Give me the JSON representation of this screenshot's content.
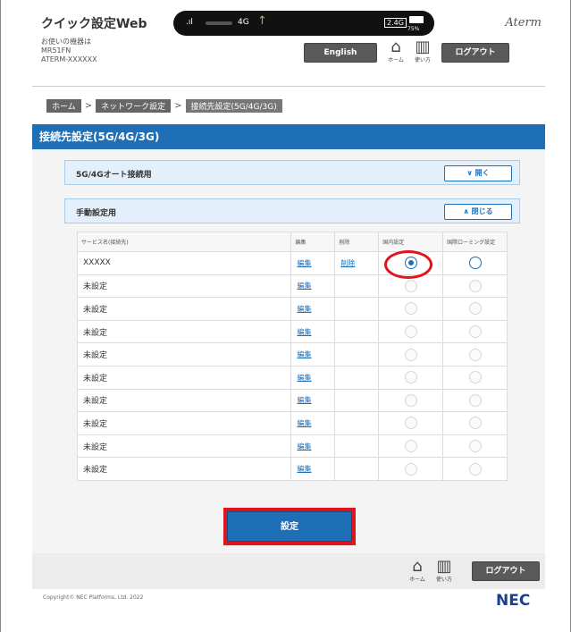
{
  "header": {
    "app_title": "クイック設定Web",
    "device_label": "お使いの機器は",
    "device_model": "MR51FN",
    "device_name": "ATERM-XXXXXX",
    "brand": "Aterm",
    "status": {
      "signal": ".ıl",
      "network": "4G",
      "band": "2.4G",
      "battery": "75%"
    },
    "english_label": "English",
    "home_caption": "ホーム",
    "help_caption": "使い方",
    "logout_label": "ログアウト"
  },
  "breadcrumb": [
    "ホーム",
    "ネットワーク設定",
    "接続先設定(5G/4G/3G)"
  ],
  "breadcrumb_sep": ">",
  "section_title": "接続先設定(5G/4G/3G)",
  "accordions": [
    {
      "label": "5G/4Gオート接続用",
      "button": "開く",
      "icon": "chevron-down-icon"
    },
    {
      "label": "手動設定用",
      "button": "閉じる",
      "icon": "chevron-up-icon"
    }
  ],
  "table": {
    "headers": [
      "サービス名(接続先)",
      "編集",
      "削除",
      "国内設定",
      "国際ローミング設定"
    ],
    "rows": [
      {
        "name": "XXXXX",
        "edit": "編集",
        "delete": "削除",
        "domestic": "selected",
        "roaming": "active"
      },
      {
        "name": "未設定",
        "edit": "編集",
        "delete": "",
        "domestic": "disabled",
        "roaming": "disabled"
      },
      {
        "name": "未設定",
        "edit": "編集",
        "delete": "",
        "domestic": "disabled",
        "roaming": "disabled"
      },
      {
        "name": "未設定",
        "edit": "編集",
        "delete": "",
        "domestic": "disabled",
        "roaming": "disabled"
      },
      {
        "name": "未設定",
        "edit": "編集",
        "delete": "",
        "domestic": "disabled",
        "roaming": "disabled"
      },
      {
        "name": "未設定",
        "edit": "編集",
        "delete": "",
        "domestic": "disabled",
        "roaming": "disabled"
      },
      {
        "name": "未設定",
        "edit": "編集",
        "delete": "",
        "domestic": "disabled",
        "roaming": "disabled"
      },
      {
        "name": "未設定",
        "edit": "編集",
        "delete": "",
        "domestic": "disabled",
        "roaming": "disabled"
      },
      {
        "name": "未設定",
        "edit": "編集",
        "delete": "",
        "domestic": "disabled",
        "roaming": "disabled"
      },
      {
        "name": "未設定",
        "edit": "編集",
        "delete": "",
        "domestic": "disabled",
        "roaming": "disabled"
      }
    ]
  },
  "submit_label": "設定",
  "footer": {
    "home_caption": "ホーム",
    "help_caption": "使い方",
    "logout_label": "ログアウト",
    "copyright": "Copyright© NEC Platforms, Ltd. 2022",
    "logo": "NEC"
  },
  "colors": {
    "accent": "#1f6fb7",
    "highlight": "#e0141e"
  }
}
